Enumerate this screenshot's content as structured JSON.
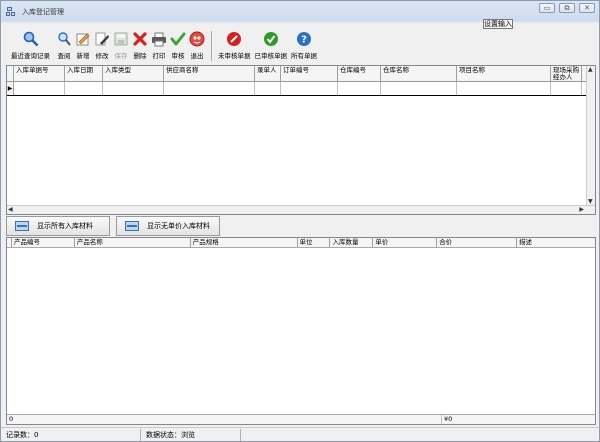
{
  "window": {
    "title": "入库登记管理",
    "setting_button": "设置输入"
  },
  "toolbar": {
    "buttons": [
      {
        "label": "最近查询记录",
        "icon": "magnifier-icon"
      },
      {
        "label": "查阅",
        "icon": "search-icon"
      },
      {
        "label": "新增",
        "icon": "new-doc-icon"
      },
      {
        "label": "修改",
        "icon": "edit-icon"
      },
      {
        "label": "保存",
        "icon": "save-icon"
      },
      {
        "label": "删除",
        "icon": "delete-icon"
      },
      {
        "label": "打印",
        "icon": "printer-icon"
      },
      {
        "label": "审核",
        "icon": "check-icon"
      },
      {
        "label": "退出",
        "icon": "exit-icon"
      },
      {
        "label": "未审核单据",
        "icon": "unapproved-icon"
      },
      {
        "label": "已审核单据",
        "icon": "approved-icon"
      },
      {
        "label": "所有单据",
        "icon": "help-icon"
      }
    ]
  },
  "main_grid": {
    "columns": [
      "入库单据号",
      "入库日期",
      "入库类型",
      "供应商名称",
      "录单人",
      "订单编号",
      "仓库编号",
      "仓库名称",
      "项目名称",
      "现场采购经办人"
    ]
  },
  "detail_buttons": {
    "show_all": "显示所有入库材料",
    "show_no_price": "显示无单价入库材料"
  },
  "detail_grid": {
    "columns": [
      "产品编号",
      "产品名称",
      "产品规格",
      "单位",
      "入库数量",
      "单价",
      "合价",
      "描述"
    ],
    "summary": {
      "count": "0",
      "amount": "¥0"
    }
  },
  "status": {
    "record_count": "记录数：0",
    "data_state": "数据状态：浏览"
  },
  "colors": {
    "title_gradient": "#dbe6f4",
    "accent_blue": "#2a6fc9",
    "delete_red": "#d62020",
    "approve_green": "#3aa52f"
  }
}
